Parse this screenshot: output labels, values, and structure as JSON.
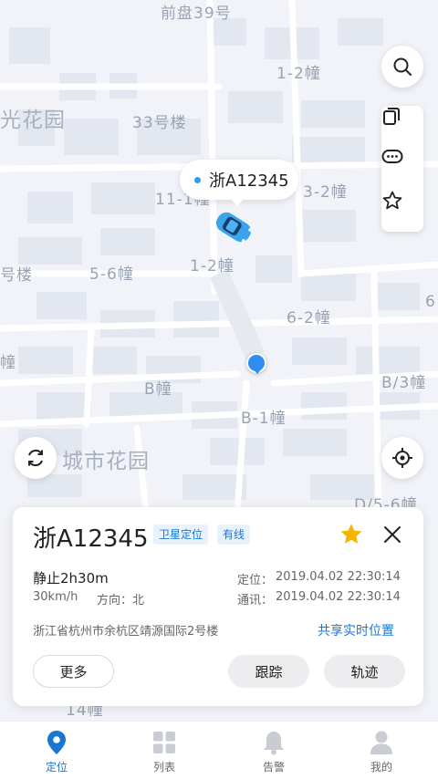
{
  "map": {
    "labels": {
      "top_cut": "前盘39号",
      "b1_2_top": "1-2幢",
      "b33": "33号楼",
      "garden_left": "光花园",
      "b11": "11-1幢",
      "b3_2": "3-2幢",
      "b_lou": "号楼",
      "b5_6": "5-6幢",
      "b1_2_mid": "1-2幢",
      "b6_2": "6-2幢",
      "b6_cut": "6",
      "b_zhuang": "幢",
      "bB": "B幢",
      "bB3": "B/3幢",
      "bB1": "B-1幢",
      "city_garden": "城市花园",
      "bD56": "D/5-6幢",
      "b14": "14幢"
    },
    "vehicle": {
      "plate_bubble": "浙A12345"
    }
  },
  "side_buttons": {
    "search_icon": "search-icon",
    "copy_icon": "copy-icon",
    "chat_icon": "chat-icon",
    "star_icon": "star-icon",
    "refresh_icon": "refresh-icon",
    "locate_icon": "locate-icon"
  },
  "panel": {
    "plate": "浙A12345",
    "tag_gps": "卫星定位",
    "tag_wired": "有线",
    "status": "静止2h30m",
    "speed": "30km/h",
    "direction": "方向：北",
    "locate_label": "定位：",
    "locate_time": "2019.04.02  22:30:14",
    "comm_label": "通讯：",
    "comm_time": "2019.04.02  22:30:14",
    "address": "浙江省杭州市余杭区靖源国际2号楼",
    "share": "共享实时位置",
    "btn_more": "更多",
    "btn_track": "跟踪",
    "btn_trace": "轨迹",
    "star_color": "#f5b400"
  },
  "tabbar": {
    "tabs": [
      {
        "label": "定位",
        "icon": "location-pin-icon",
        "active": true
      },
      {
        "label": "列表",
        "icon": "grid-icon",
        "active": false
      },
      {
        "label": "告警",
        "icon": "bell-icon",
        "active": false
      },
      {
        "label": "我的",
        "icon": "user-icon",
        "active": false
      }
    ]
  },
  "colors": {
    "accent": "#1976d2",
    "tag_bg": "#e7f2fd",
    "map_bg": "#f1f3f8"
  }
}
